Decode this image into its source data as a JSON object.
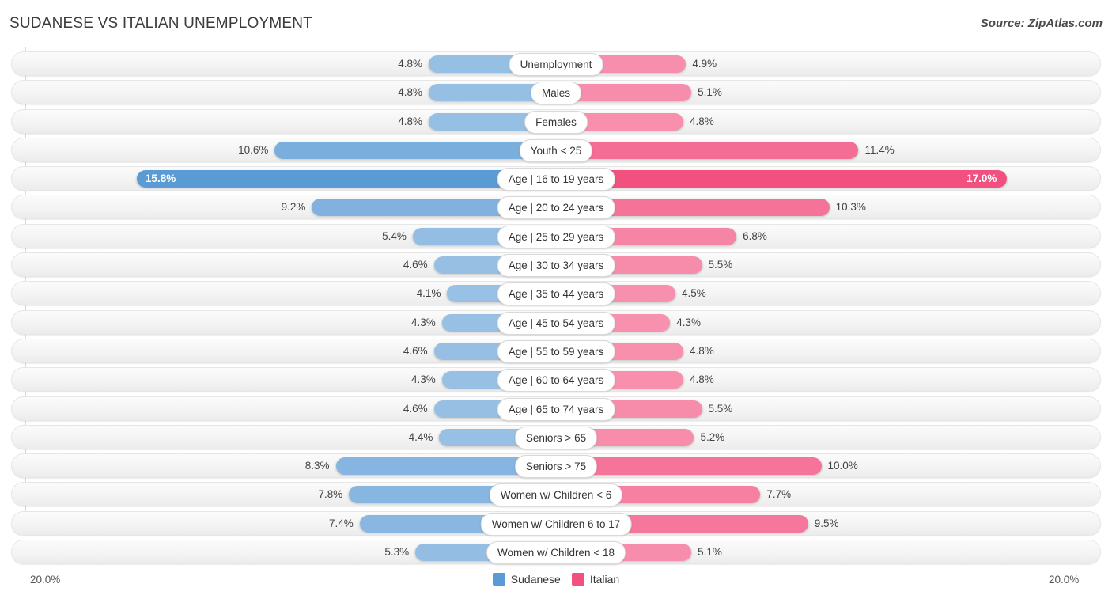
{
  "header": {
    "title": "SUDANESE VS ITALIAN UNEMPLOYMENT",
    "source": "Source: ZipAtlas.com"
  },
  "footer": {
    "axis_min_label": "20.0%",
    "axis_max_label": "20.0%",
    "legend": [
      {
        "label": "Sudanese",
        "color": "#5b9bd5"
      },
      {
        "label": "Italian",
        "color": "#f2507f"
      }
    ]
  },
  "chart_data": {
    "type": "bar",
    "title": "SUDANESE VS ITALIAN UNEMPLOYMENT",
    "subtitle": "Source: ZipAtlas.com",
    "orientation": "horizontal-diverging",
    "xlabel": "",
    "ylabel": "",
    "axis_range": [
      0,
      20
    ],
    "axis_unit": "%",
    "grid": true,
    "legend_position": "bottom-center",
    "categories": [
      "Unemployment",
      "Males",
      "Females",
      "Youth < 25",
      "Age | 16 to 19 years",
      "Age | 20 to 24 years",
      "Age | 25 to 29 years",
      "Age | 30 to 34 years",
      "Age | 35 to 44 years",
      "Age | 45 to 54 years",
      "Age | 55 to 59 years",
      "Age | 60 to 64 years",
      "Age | 65 to 74 years",
      "Seniors > 65",
      "Seniors > 75",
      "Women w/ Children < 6",
      "Women w/ Children 6 to 17",
      "Women w/ Children < 18"
    ],
    "series": [
      {
        "name": "Sudanese",
        "color": "#5b9bd5",
        "values": [
          4.8,
          4.8,
          4.8,
          10.6,
          15.8,
          9.2,
          5.4,
          4.6,
          4.1,
          4.3,
          4.6,
          4.3,
          4.6,
          4.4,
          8.3,
          7.8,
          7.4,
          5.3
        ],
        "labels": [
          "4.8%",
          "4.8%",
          "4.8%",
          "10.6%",
          "15.8%",
          "9.2%",
          "5.4%",
          "4.6%",
          "4.1%",
          "4.3%",
          "4.6%",
          "4.3%",
          "4.6%",
          "4.4%",
          "8.3%",
          "7.8%",
          "7.4%",
          "5.3%"
        ]
      },
      {
        "name": "Italian",
        "color": "#f2507f",
        "values": [
          4.9,
          5.1,
          4.8,
          11.4,
          17.0,
          10.3,
          6.8,
          5.5,
          4.5,
          4.3,
          4.8,
          4.8,
          5.5,
          5.2,
          10.0,
          7.7,
          9.5,
          5.1
        ],
        "labels": [
          "4.9%",
          "5.1%",
          "4.8%",
          "11.4%",
          "17.0%",
          "10.3%",
          "6.8%",
          "5.5%",
          "4.5%",
          "4.3%",
          "4.8%",
          "4.8%",
          "5.5%",
          "5.2%",
          "10.0%",
          "7.7%",
          "9.5%",
          "5.1%"
        ]
      }
    ]
  }
}
